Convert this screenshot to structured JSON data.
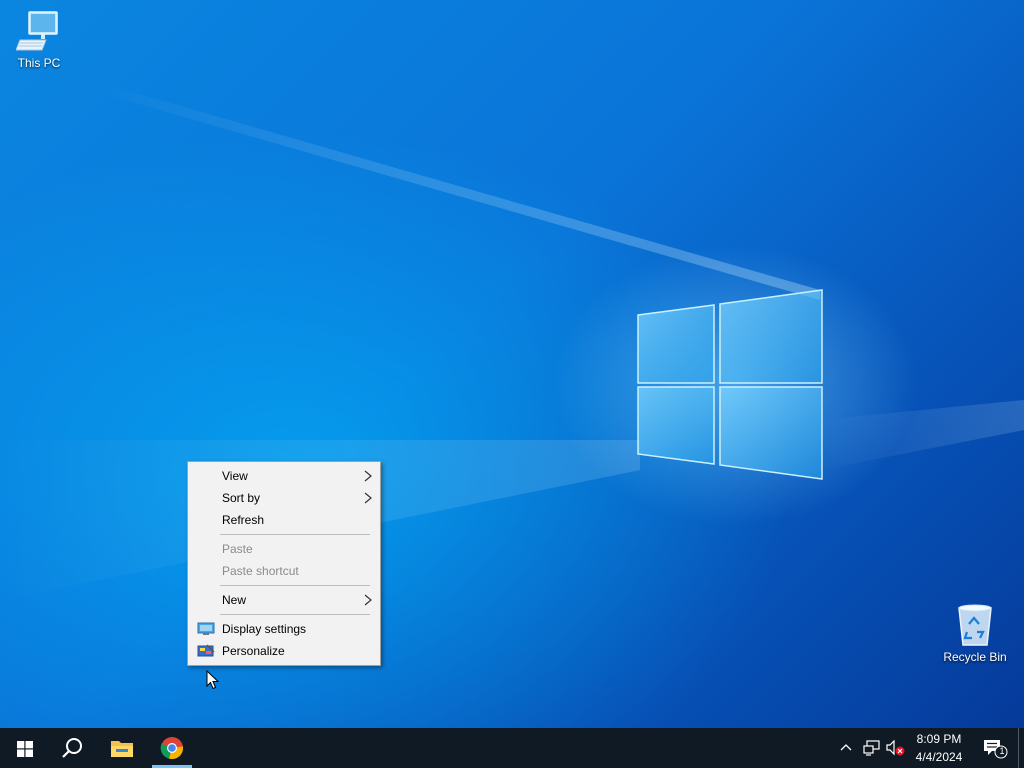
{
  "desktop": {
    "icons": [
      {
        "label": "This PC"
      },
      {
        "label": "Recycle Bin"
      }
    ]
  },
  "context_menu": {
    "items": [
      {
        "label": "View",
        "submenu": true,
        "enabled": true
      },
      {
        "label": "Sort by",
        "submenu": true,
        "enabled": true
      },
      {
        "label": "Refresh",
        "enabled": true
      },
      {
        "label": "Paste",
        "enabled": false
      },
      {
        "label": "Paste shortcut",
        "enabled": false
      },
      {
        "label": "New",
        "submenu": true,
        "enabled": true
      },
      {
        "label": "Display settings",
        "icon": "display-icon",
        "enabled": true
      },
      {
        "label": "Personalize",
        "icon": "personalize-icon",
        "enabled": true
      }
    ]
  },
  "taskbar": {
    "pinned": [
      "start-icon",
      "search-icon",
      "file-explorer-icon",
      "chrome-icon"
    ],
    "active_app": "chrome-icon",
    "tray": {
      "icons": [
        "chevron-up-icon",
        "network-icon",
        "volume-muted-icon"
      ],
      "time": "8:09 PM",
      "date": "4/4/2024",
      "notification_count": "1"
    }
  },
  "colors": {
    "taskbar": "#101a24",
    "menu_bg": "#f2f2f2",
    "accent": "#7ec3f5"
  }
}
